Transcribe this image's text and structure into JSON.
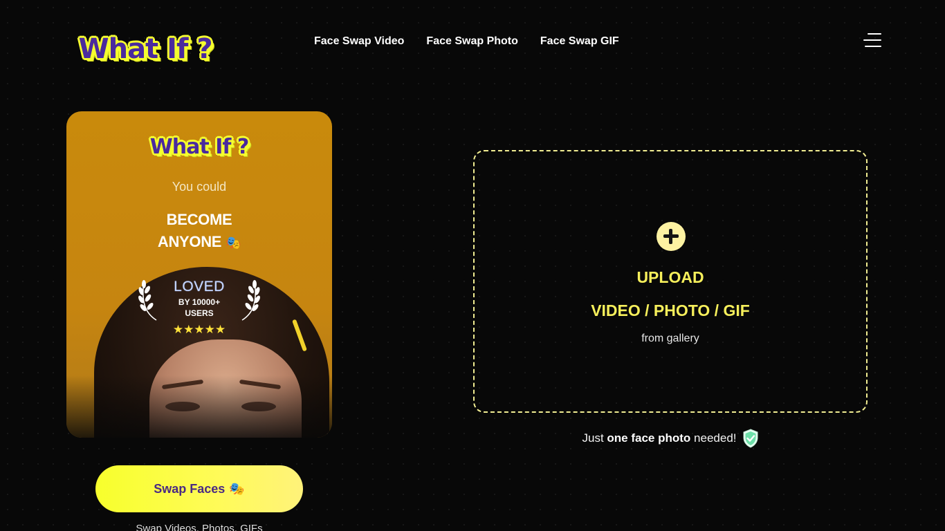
{
  "header": {
    "logo_text": "What If ?",
    "nav": [
      "Face Swap Video",
      "Face Swap Photo",
      "Face Swap GIF"
    ]
  },
  "promo": {
    "logo_text": "What If ?",
    "subtitle": "You could",
    "headline_line1": "BECOME",
    "headline_line2": "ANYONE",
    "headline_icon": "🎭",
    "badge": {
      "title": "LOVED",
      "line1": "BY 10000+",
      "line2": "USERS",
      "stars": "★★★★★",
      "rating": 5
    }
  },
  "cta": {
    "button_label": "Swap Faces",
    "button_icon": "🎭",
    "subtext": "Swap Videos, Photos, GIFs"
  },
  "upload": {
    "title": "UPLOAD",
    "types": "VIDEO / PHOTO / GIF",
    "subtitle": "from gallery"
  },
  "note": {
    "prefix": "Just",
    "bold": "one face photo",
    "suffix": "needed!"
  },
  "colors": {
    "accent_yellow": "#f6ef5b",
    "button_yellow": "#f7ff2c",
    "logo_purple": "#4a2a9e",
    "background": "#080808",
    "card_orange": "#c98a0c",
    "shield_green": "#6de0a9"
  }
}
